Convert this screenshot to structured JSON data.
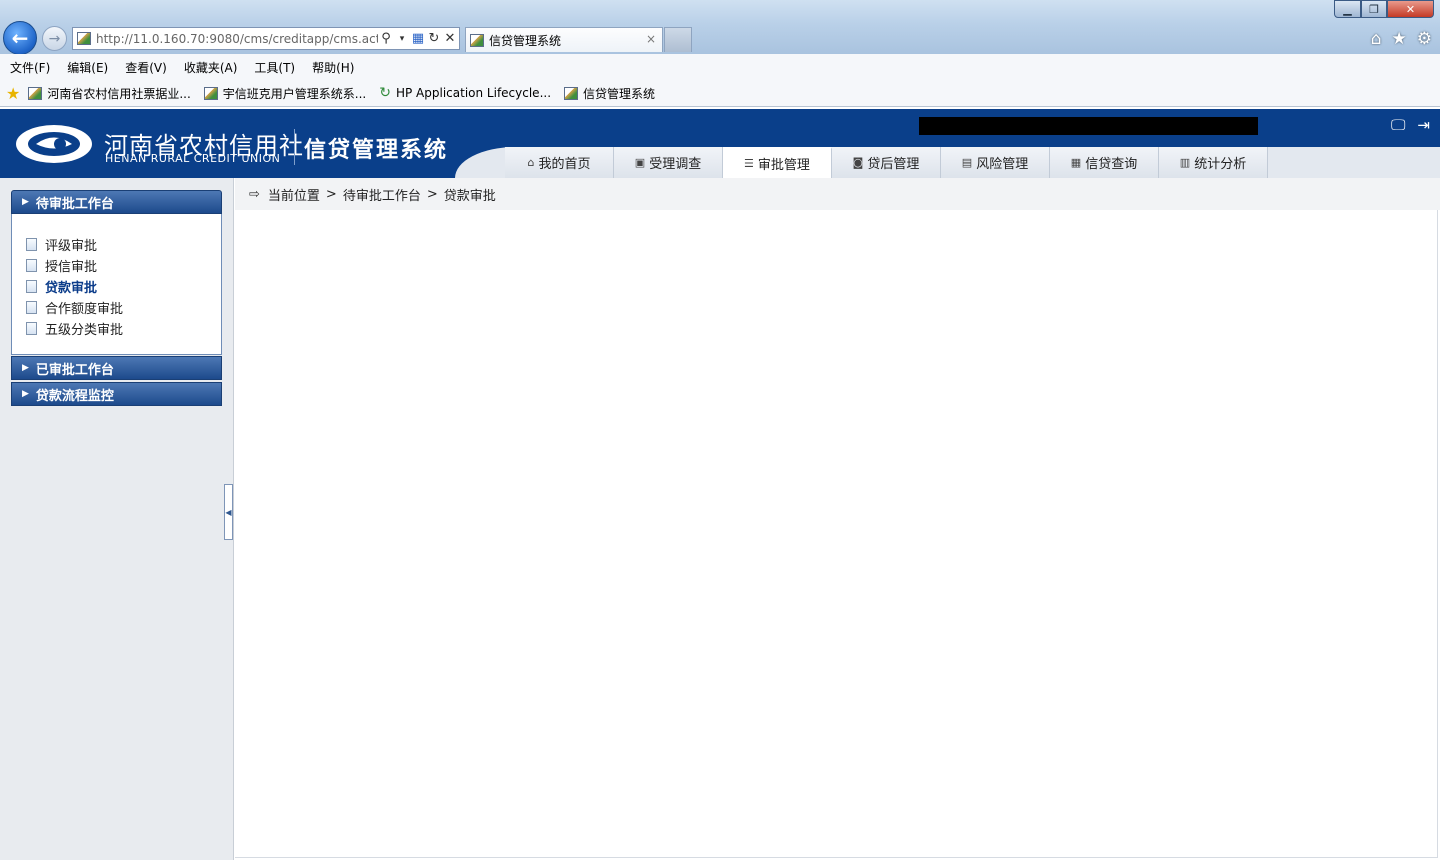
{
  "browser": {
    "url": "http://11.0.160.70:9080/cms/creditapp/cms.actic",
    "tab_title": "信贷管理系统",
    "tab_close": "×",
    "menu": [
      "文件(F)",
      "编辑(E)",
      "查看(V)",
      "收藏夹(A)",
      "工具(T)",
      "帮助(H)"
    ],
    "favorites": [
      "河南省农村信用社票据业...",
      "宇信班克用户管理系统系...",
      "HP Application Lifecycle...",
      "信贷管理系统"
    ],
    "window_controls": {
      "min": "▁",
      "max": "❐",
      "close": "✕"
    },
    "right_icons": {
      "home": "⌂",
      "favorites": "★",
      "tools": "⚙"
    }
  },
  "header": {
    "brand_cn": "河南省农村信用社",
    "brand_en": "HENAN RURAL CREDIT UNION",
    "system_title": "信贷管理系统",
    "icons": {
      "monitor": "🖵",
      "logout": "⇥"
    }
  },
  "nav": {
    "items": [
      {
        "label": "我的首页",
        "icon": "⌂"
      },
      {
        "label": "受理调查",
        "icon": "▣"
      },
      {
        "label": "审批管理",
        "icon": "☰"
      },
      {
        "label": "贷后管理",
        "icon": "◙"
      },
      {
        "label": "风险管理",
        "icon": "▤"
      },
      {
        "label": "信贷查询",
        "icon": "▦"
      },
      {
        "label": "统计分析",
        "icon": "▥"
      }
    ],
    "active_index": 2
  },
  "sidebar": {
    "sections": [
      {
        "title": "待审批工作台",
        "items": [
          "评级审批",
          "授信审批",
          "贷款审批",
          "合作额度审批",
          "五级分类审批"
        ]
      },
      {
        "title": "已审批工作台"
      },
      {
        "title": "贷款流程监控"
      }
    ],
    "active_item": "贷款审批",
    "arrow": "▶",
    "collapse_glyph": "◀"
  },
  "breadcrumb": {
    "current_label": "当前位置",
    "sep": ">",
    "path": [
      "待审批工作台",
      "贷款审批"
    ]
  }
}
